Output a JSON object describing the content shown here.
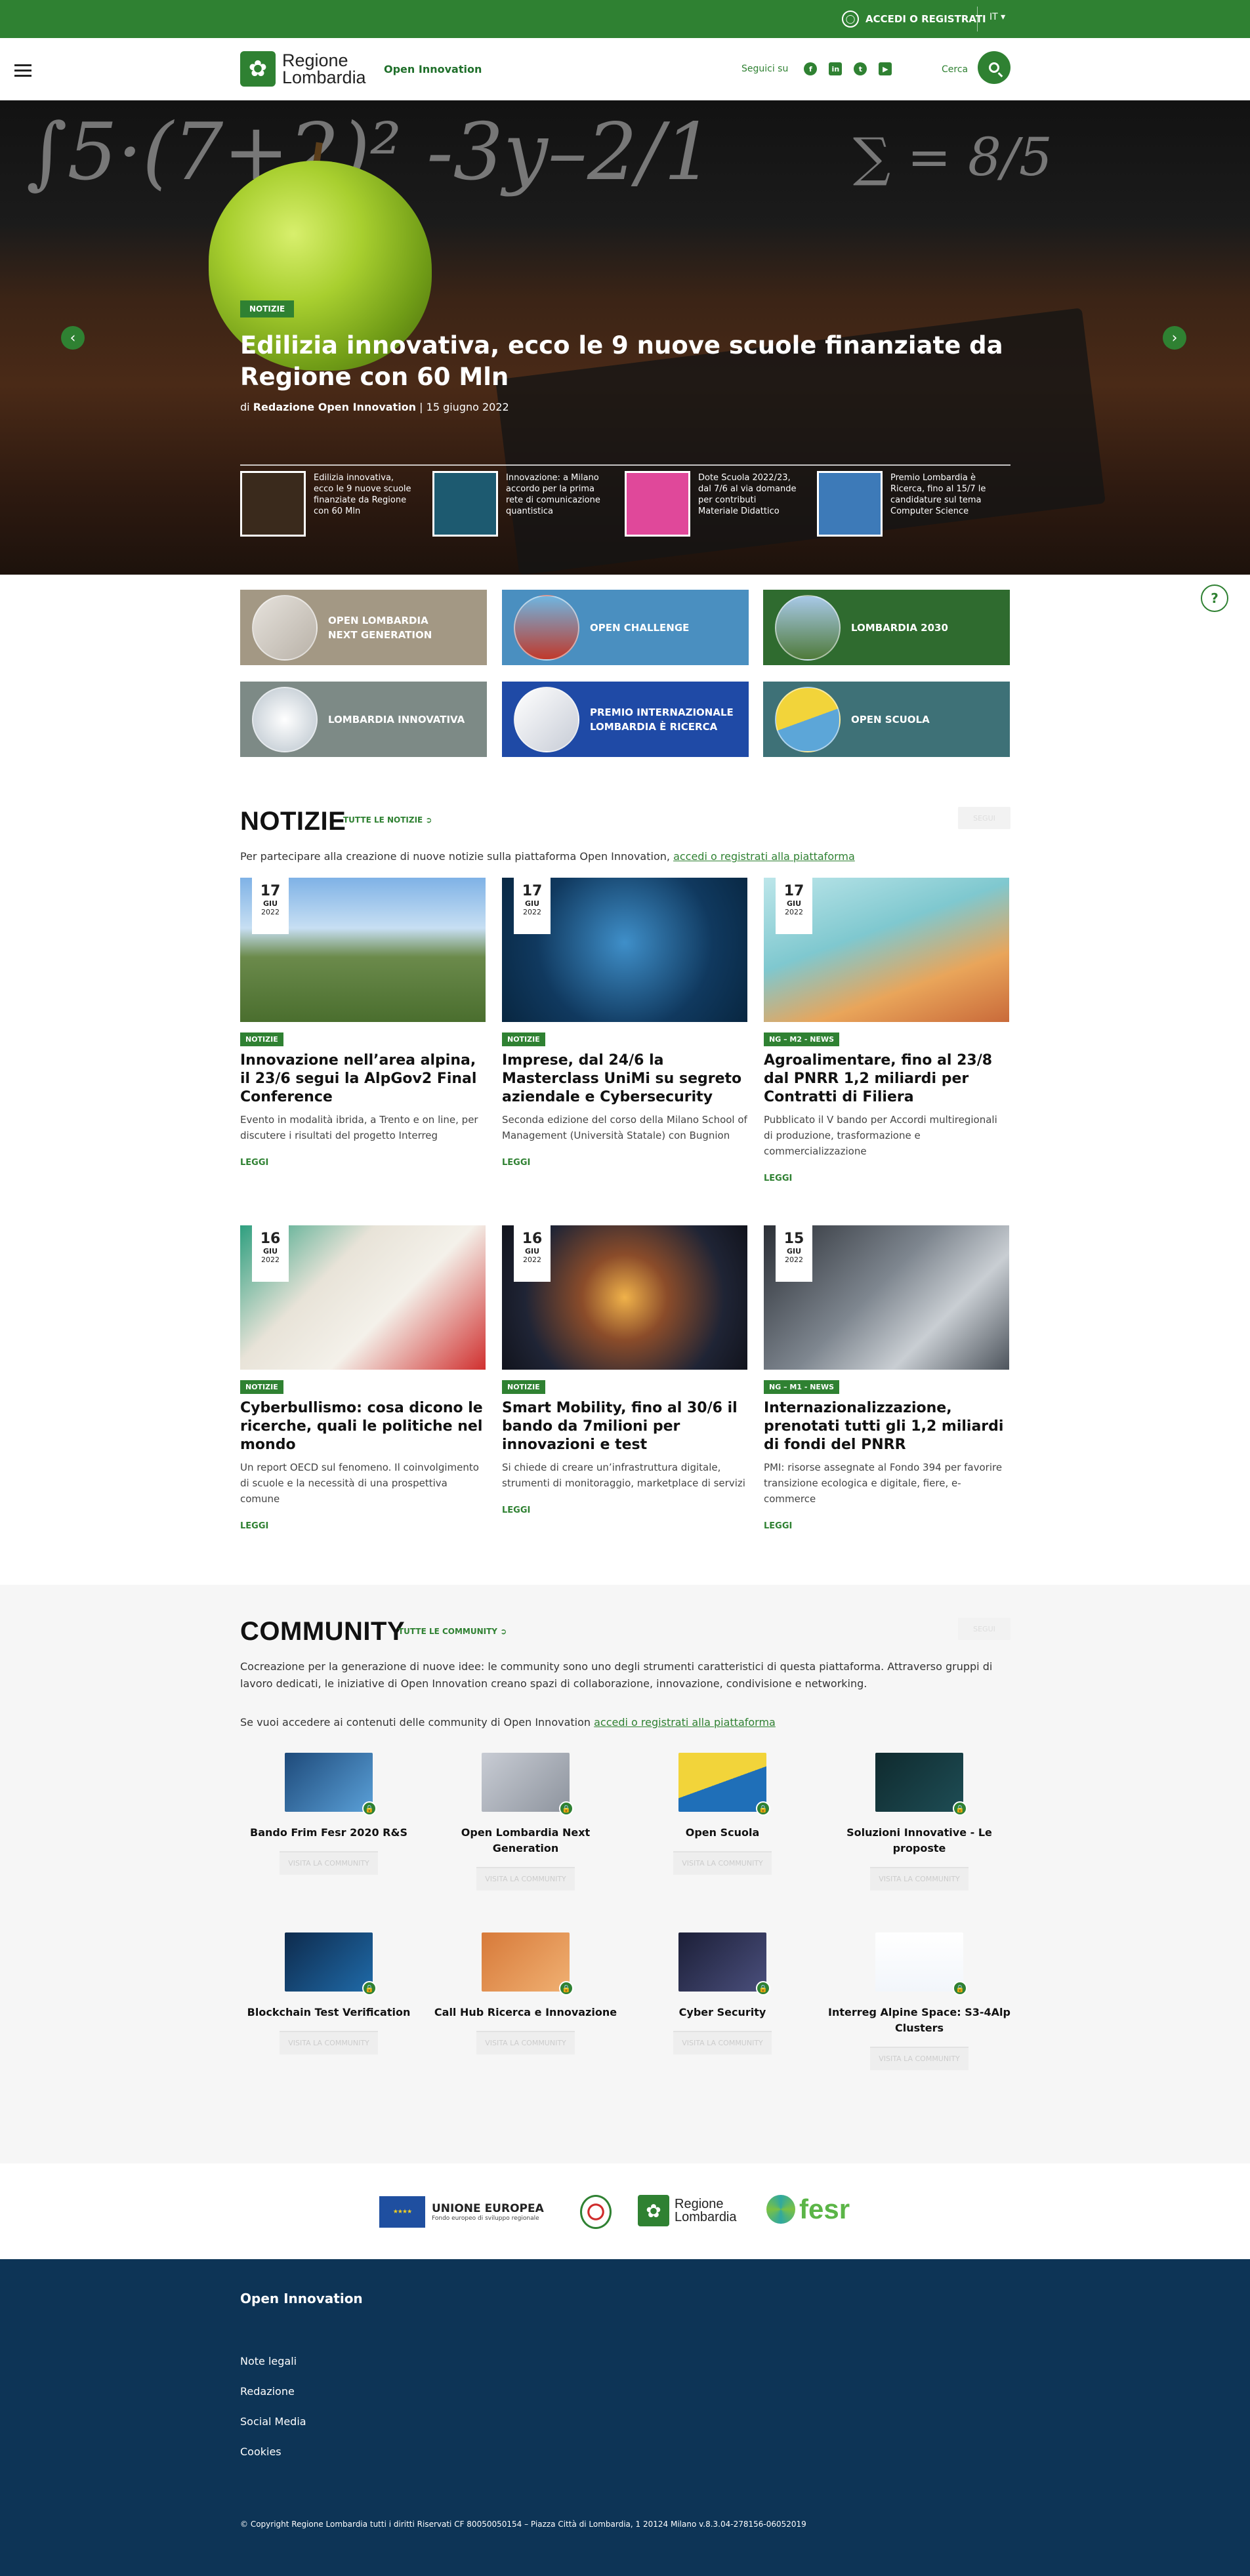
{
  "topbar": {
    "login_label": "ACCEDI O REGISTRATI",
    "lang": "IT"
  },
  "header": {
    "logo_line1": "Regione",
    "logo_line2": "Lombardia",
    "site_name": "Open Innovation",
    "follow_label": "Seguici su",
    "social": [
      "facebook",
      "linkedin",
      "twitter",
      "youtube"
    ],
    "search_label": "Cerca"
  },
  "hero": {
    "badge": "NOTIZIE",
    "title": "Edilizia innovativa, ecco le 9 nuove scuole finanziate da Regione con 60 Mln",
    "meta_prefix": "di",
    "author": "Redazione Open Innovation",
    "date": "| 15 giugno 2022",
    "thumbs": [
      {
        "text": "Edilizia innovativa, ecco le 9 nuove scuole finanziate da Regione con 60 Mln",
        "color": "#3a2a1c"
      },
      {
        "text": "Innovazione: a Milano accordo per la prima rete di comunicazione quantistica",
        "color": "#1d5a70"
      },
      {
        "text": "Dote Scuola 2022/23, dal 7/6 al via domande per contributi Materiale Didattico",
        "color": "#e0489a"
      },
      {
        "text": "Premio Lombardia è Ricerca, fino al 15/7 le candidature sul tema Computer Science",
        "color": "#3d7ab8"
      }
    ]
  },
  "tiles": [
    {
      "label": "OPEN LOMBARDIA\nNEXT GENERATION",
      "bg": "#a39884"
    },
    {
      "label": "OPEN CHALLENGE",
      "bg": "#4a8fc0"
    },
    {
      "label": "LOMBARDIA 2030",
      "bg": "#2f6b2f"
    },
    {
      "label": "LOMBARDIA INNOVATIVA",
      "bg": "#7d8a86"
    },
    {
      "label": "PREMIO INTERNAZIONALE\nLOMBARDIA È RICERCA",
      "bg": "#1f4aa6"
    },
    {
      "label": "OPEN SCUOLA",
      "bg": "#3e7177"
    }
  ],
  "news": {
    "title": "NOTIZIE",
    "all_link": "TUTTE LE NOTIZIE",
    "ghost_button": "SEGUI",
    "intro_text": "Per partecipare alla creazione di nuove notizie sulla piattaforma Open Innovation,",
    "intro_link": "accedi o registrati alla piattaforma",
    "read_more": "LEGGI",
    "items": [
      {
        "day": "17",
        "month": "GIU",
        "year": "2022",
        "tag": "NOTIZIE",
        "title": "Innovazione nell’area alpina, il 23/6 segui la AlpGov2 Final Conference",
        "desc": "Evento in modalità ibrida, a Trento e on line, per discutere i risultati del progetto Interreg",
        "img": "linear-gradient(180deg,#7fb2e6 0%,#c7dff3 35%,#6b8a4b 55%,#4a6e2e 100%)"
      },
      {
        "day": "17",
        "month": "GIU",
        "year": "2022",
        "tag": "NOTIZIE",
        "title": "Imprese, dal 24/6 la Masterclass UniMi su segreto aziendale e Cybersecurity",
        "desc": "Seconda edizione del corso della Milano School of Management (Università Statale) con Bugnion",
        "img": "radial-gradient(circle at 50% 45%,#3f8fc9 0%,#10395f 60%,#082640 100%)"
      },
      {
        "day": "17",
        "month": "GIU",
        "year": "2022",
        "tag": "NG – M2 - NEWS",
        "title": "Agroalimentare, fino al 23/8 dal PNRR 1,2 miliardi per Contratti di Filiera",
        "desc": "Pubblicato il V bando per Accordi multiregionali di produzione, trasformazione e commercializzazione",
        "img": "linear-gradient(160deg,#bde6ea 0%,#7fc8cf 40%,#e9a55a 70%,#c96a3a 100%)"
      },
      {
        "day": "16",
        "month": "GIU",
        "year": "2022",
        "tag": "NOTIZIE",
        "title": "Cyberbullismo: cosa dicono le ricerche, quali le politiche nel mondo",
        "desc": "Un report OECD sul fenomeno. Il coinvolgimento di scuole e la necessità di una prospettiva comune",
        "img": "linear-gradient(135deg,#2e9f7f 0%,#e8e3d8 35%,#f4f1ea 60%,#d0302f 100%)"
      },
      {
        "day": "16",
        "month": "GIU",
        "year": "2022",
        "tag": "NOTIZIE",
        "title": "Smart Mobility, fino al 30/6 il bando da 7milioni per innovazioni e test",
        "desc": "Si chiede di creare un’infrastruttura digitale, strumenti di monitoraggio, marketplace di servizi",
        "img": "radial-gradient(circle at 50% 50%,#f0b24a 0%,#8b4c2a 30%,#1f2435 70%,#11131c 100%)"
      },
      {
        "day": "15",
        "month": "GIU",
        "year": "2022",
        "tag": "NG – M1 - NEWS",
        "title": "Internazionalizzazione, prenotati tutti gli 1,2 miliardi di fondi del PNRR",
        "desc": "PMI: risorse assegnate al Fondo 394 per favorire transizione ecologica e digitale, fiere, e-commerce",
        "img": "linear-gradient(135deg,#2b2f36 0%,#7e868f 45%,#c9ced3 70%,#4d545c 100%)"
      }
    ]
  },
  "community": {
    "title": "COMMUNITY",
    "all_link": "TUTTE LE COMMUNITY",
    "ghost_button": "SEGUI",
    "desc": "Cocreazione per la generazione di nuove idee: le community sono uno degli strumenti caratteristici di questa piattaforma. Attraverso gruppi di lavoro dedicati, le iniziative di Open Innovation creano spazi di collaborazione, innovazione, condivisione e networking.",
    "access_text": "Se vuoi accedere ai contenuti delle community di Open Innovation",
    "access_link": "accedi o registrati alla piattaforma",
    "button_label": "VISITA LA COMMUNITY",
    "items": [
      {
        "name": "Bando Frim Fesr 2020 R&S",
        "img": "linear-gradient(135deg,#1e4a7a,#5aa0d8)"
      },
      {
        "name": "Open Lombardia Next Generation",
        "img": "linear-gradient(135deg,#c8ccd4,#8e949e)"
      },
      {
        "name": "Open Scuola",
        "img": "linear-gradient(160deg,#f2d43a 50%,#1f6fb8 50%)"
      },
      {
        "name": "Soluzioni Innovative - Le proposte",
        "img": "linear-gradient(135deg,#0f2a2e,#1e4d55)"
      },
      {
        "name": "Blockchain Test Verification",
        "img": "linear-gradient(135deg,#0e2b4d,#1f6aa8)"
      },
      {
        "name": "Call Hub Ricerca e Innovazione",
        "img": "linear-gradient(135deg,#d77a3a,#f0b072)"
      },
      {
        "name": "Cyber Security",
        "img": "linear-gradient(135deg,#1c1f38,#4a4f7c)"
      },
      {
        "name": "Interreg Alpine Space: S3-4Alp Clusters",
        "img": "linear-gradient(180deg,#ffffff,#f2f6fb)"
      }
    ]
  },
  "partners": {
    "eu_title": "UNIONE EUROPEA",
    "eu_sub": "Fondo europeo di sviluppo regionale",
    "rl_line1": "Regione",
    "rl_line2": "Lombardia",
    "fesr": "fesr"
  },
  "footer": {
    "title": "Open Innovation",
    "links": [
      "Note legali",
      "Redazione",
      "Social Media",
      "Cookies"
    ],
    "copyright": "© Copyright Regione Lombardia tutti i diritti Riservati CF 80050050154 – Piazza Città di Lombardia, 1 20124 Milano v.8.3.04-278156-06052019"
  }
}
